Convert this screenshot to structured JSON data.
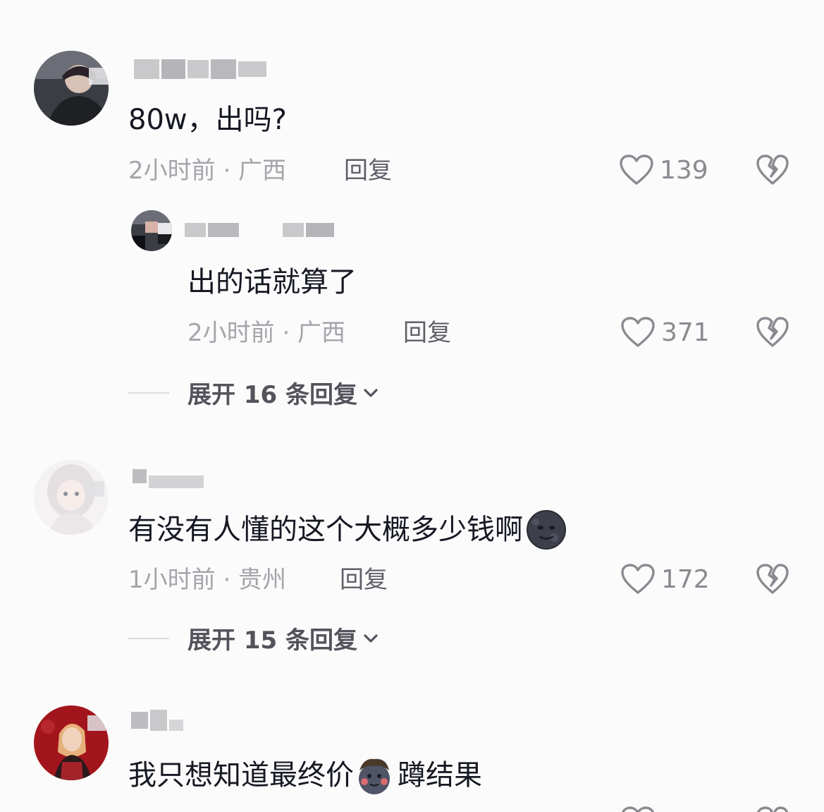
{
  "comments": [
    {
      "text": "80w，出吗?",
      "time_location": "2小时前 · 广西",
      "reply_label": "回复",
      "likes": "139",
      "replies": [
        {
          "text": "出的话就算了",
          "time_location": "2小时前 · 广西",
          "reply_label": "回复",
          "likes": "371"
        }
      ],
      "expand_label": "展开 16 条回复"
    },
    {
      "text": "有没有人懂的这个大概多少钱啊",
      "emoji": "new-moon-face",
      "time_location": "1小时前 · 贵州",
      "reply_label": "回复",
      "likes": "172",
      "expand_label": "展开 15 条回复"
    },
    {
      "text_before_emoji": "我只想知道最终价",
      "emoji": "squatting-face",
      "text_after_emoji": "蹲结果"
    }
  ],
  "icons": {
    "like": "heart-outline-icon",
    "dislike": "broken-heart-icon",
    "expand": "chevron-down-icon"
  },
  "colors": {
    "background": "#fbfbfb",
    "text": "#161823",
    "meta": "#a4a5ab",
    "action": "#5f6068"
  }
}
